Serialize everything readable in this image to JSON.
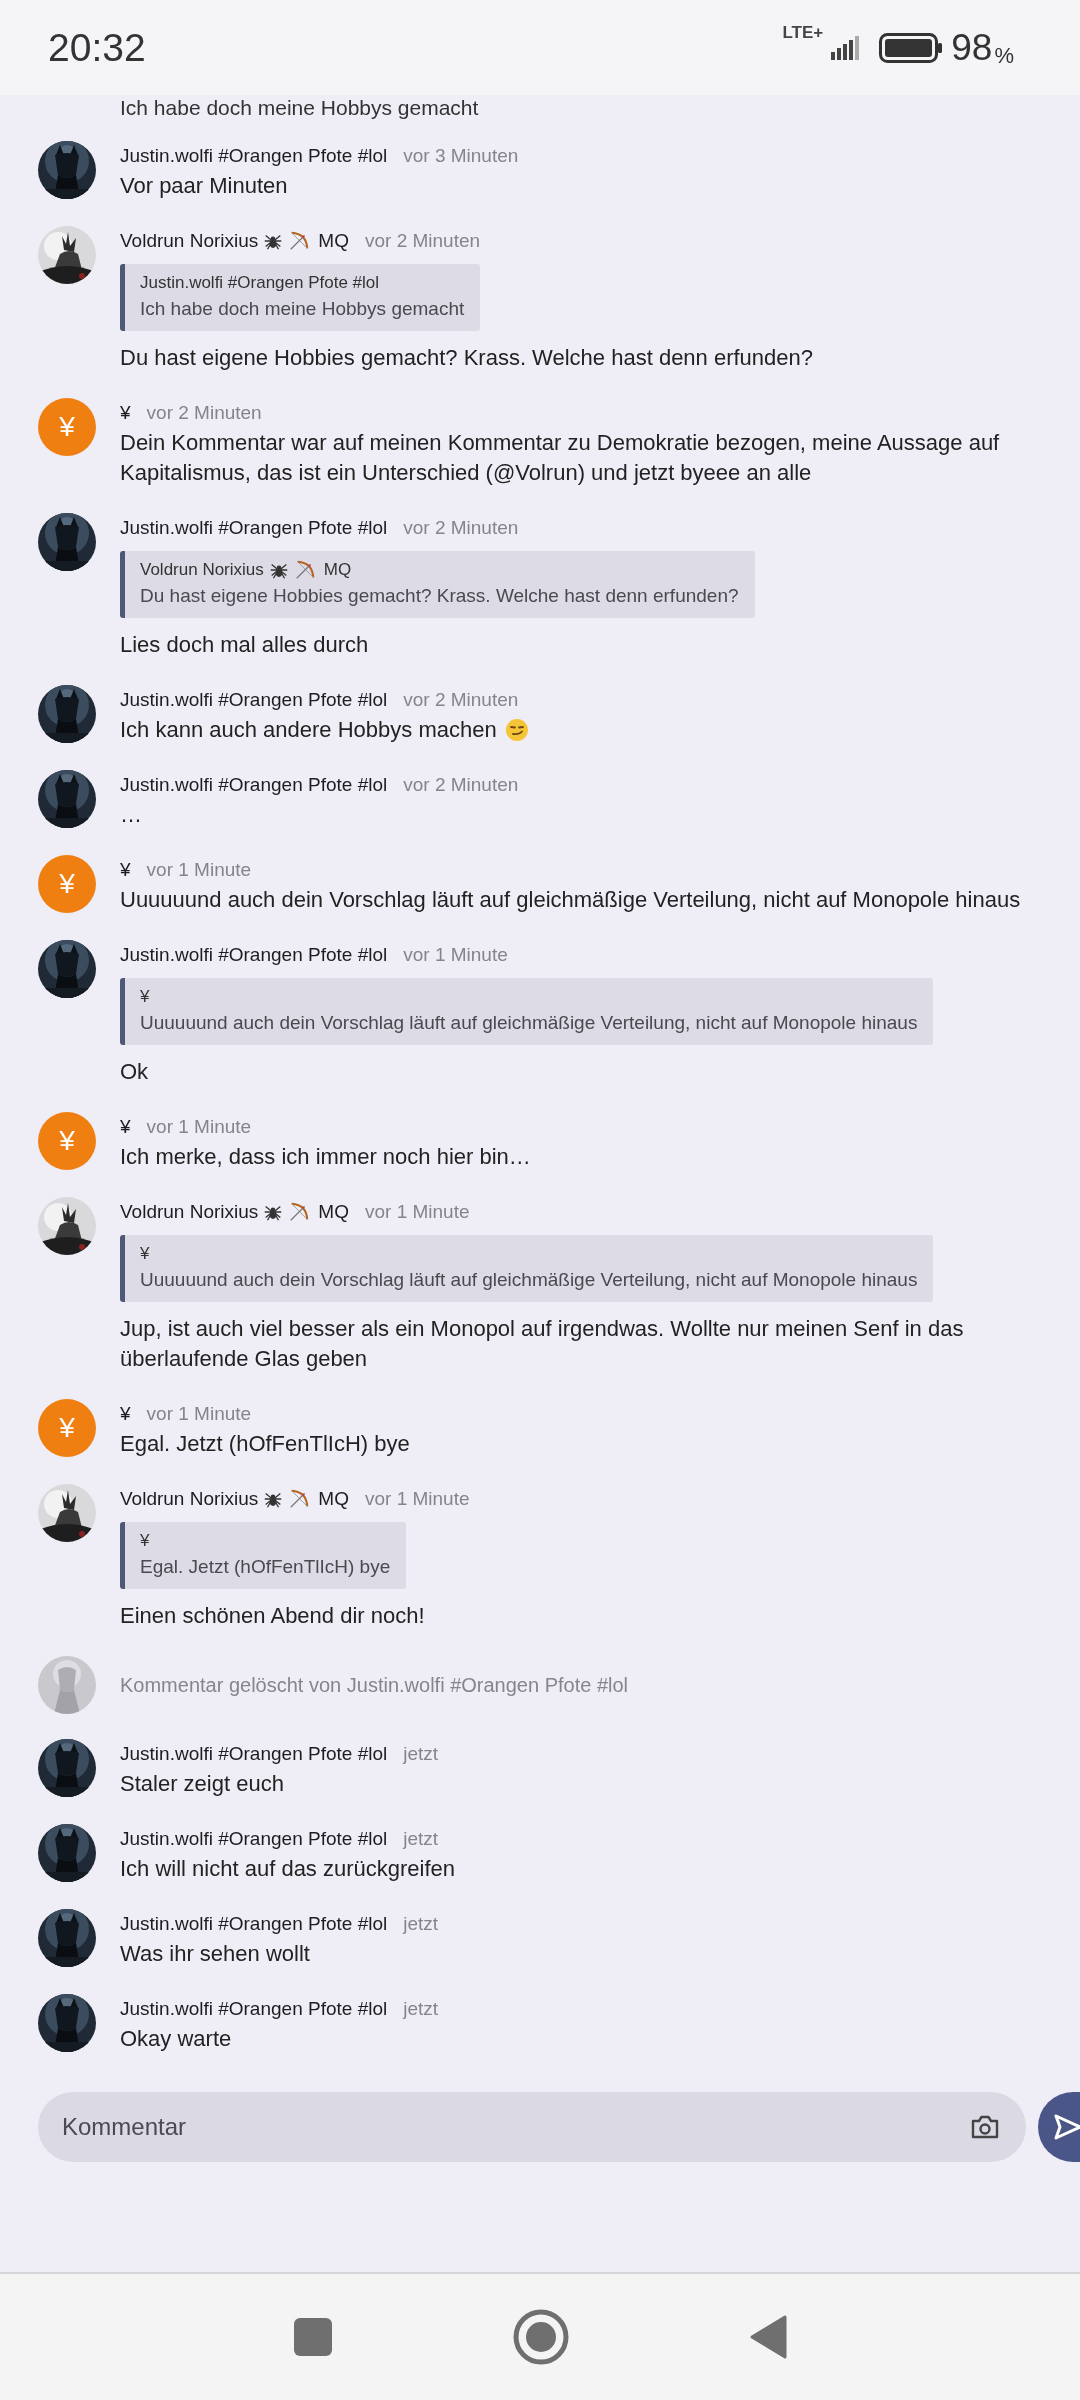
{
  "status_bar": {
    "time": "20:32",
    "network": "LTE+",
    "battery": "98",
    "battery_unit": "%"
  },
  "cut_text": "Ich habe doch meine Hobbys gemacht",
  "comments": [
    {
      "kind": "message",
      "avatar": {
        "kind": "picture_dark"
      },
      "author": "Justin.wolfi #Orangen Pfote #lol",
      "time": "vor 3 Minuten",
      "text": "Vor paar Minuten"
    },
    {
      "kind": "message",
      "avatar": {
        "kind": "picture_light"
      },
      "author": "Voldrun Norixius",
      "author_icons": [
        {
          "kind": "spider"
        },
        {
          "kind": "bow"
        }
      ],
      "tag": "MQ",
      "time": "vor 2 Minuten",
      "quote": {
        "author": "Justin.wolfi #Orangen Pfote #lol",
        "text": "Ich habe doch meine Hobbys gemacht"
      },
      "text": "Du hast eigene Hobbies gemacht? Krass. Welche hast denn erfunden?"
    },
    {
      "kind": "message",
      "avatar": {
        "kind": "letter",
        "text": "¥"
      },
      "author": "¥",
      "time": "vor 2 Minuten",
      "text": "Dein Kommentar war auf meinen Kommentar zu Demokratie bezogen, meine Aussage auf Kapitalismus, das ist ein Unterschied (@Volrun) und jetzt byeee an alle"
    },
    {
      "kind": "message",
      "avatar": {
        "kind": "picture_dark"
      },
      "author": "Justin.wolfi #Orangen Pfote #lol",
      "time": "vor 2 Minuten",
      "quote": {
        "author": "Voldrun Norixius",
        "author_icons": [
          {
            "kind": "spider"
          },
          {
            "kind": "bow"
          }
        ],
        "tag": "MQ",
        "text": "Du hast eigene Hobbies gemacht? Krass. Welche hast denn erfunden?"
      },
      "text": "Lies doch mal alles durch"
    },
    {
      "kind": "message",
      "avatar": {
        "kind": "picture_dark"
      },
      "author": "Justin.wolfi #Orangen Pfote #lol",
      "time": "vor 2 Minuten",
      "text": "Ich kann auch andere Hobbys machen",
      "text_icon": {
        "kind": "smirk"
      }
    },
    {
      "kind": "message",
      "avatar": {
        "kind": "picture_dark"
      },
      "author": "Justin.wolfi #Orangen Pfote #lol",
      "time": "vor 2 Minuten",
      "text": "…"
    },
    {
      "kind": "message",
      "avatar": {
        "kind": "letter",
        "text": "¥"
      },
      "author": "¥",
      "time": "vor 1 Minute",
      "text": "Uuuuuund auch dein Vorschlag läuft auf gleichmäßige Verteilung, nicht auf Monopole hinaus"
    },
    {
      "kind": "message",
      "avatar": {
        "kind": "picture_dark"
      },
      "author": "Justin.wolfi #Orangen Pfote #lol",
      "time": "vor 1 Minute",
      "quote": {
        "author": "¥",
        "text": "Uuuuuund auch dein Vorschlag läuft auf gleichmäßige Verteilung, nicht auf Monopole hinaus"
      },
      "text": "Ok"
    },
    {
      "kind": "message",
      "avatar": {
        "kind": "letter",
        "text": "¥"
      },
      "author": "¥",
      "time": "vor 1 Minute",
      "text": "Ich merke, dass ich immer noch hier bin…"
    },
    {
      "kind": "message",
      "avatar": {
        "kind": "picture_light"
      },
      "author": "Voldrun Norixius",
      "author_icons": [
        {
          "kind": "spider"
        },
        {
          "kind": "bow"
        }
      ],
      "tag": "MQ",
      "time": "vor 1 Minute",
      "quote": {
        "author": "¥",
        "text": "Uuuuuund auch dein Vorschlag läuft auf gleichmäßige Verteilung, nicht auf Monopole hinaus"
      },
      "text": "Jup, ist auch viel besser als ein Monopol auf irgendwas. Wollte nur meinen Senf in das überlaufende Glas geben"
    },
    {
      "kind": "message",
      "avatar": {
        "kind": "letter",
        "text": "¥"
      },
      "author": "¥",
      "time": "vor 1 Minute",
      "text": "Egal. Jetzt (hOfFenTlIcH) bye"
    },
    {
      "kind": "message",
      "avatar": {
        "kind": "picture_light"
      },
      "author": "Voldrun Norixius",
      "author_icons": [
        {
          "kind": "spider"
        },
        {
          "kind": "bow"
        }
      ],
      "tag": "MQ",
      "time": "vor 1 Minute",
      "quote": {
        "author": "¥",
        "text": "Egal. Jetzt (hOfFenTlIcH) bye"
      },
      "text": "Einen schönen Abend dir noch!"
    },
    {
      "kind": "deleted",
      "avatar": {
        "kind": "picture_faded"
      },
      "text": "Kommentar gelöscht von Justin.wolfi #Orangen Pfote #lol"
    },
    {
      "kind": "message",
      "avatar": {
        "kind": "picture_dark"
      },
      "author": "Justin.wolfi #Orangen Pfote #lol",
      "time": "jetzt",
      "text": "Staler zeigt euch"
    },
    {
      "kind": "message",
      "avatar": {
        "kind": "picture_dark"
      },
      "author": "Justin.wolfi #Orangen Pfote #lol",
      "time": "jetzt",
      "text": "Ich will nicht auf das zurückgreifen"
    },
    {
      "kind": "message",
      "avatar": {
        "kind": "picture_dark"
      },
      "author": "Justin.wolfi #Orangen Pfote #lol",
      "time": "jetzt",
      "text": "Was ihr sehen wollt"
    },
    {
      "kind": "message",
      "avatar": {
        "kind": "picture_dark"
      },
      "author": "Justin.wolfi #Orangen Pfote #lol",
      "time": "jetzt",
      "text": "Okay warte"
    }
  ],
  "composer": {
    "placeholder": "Kommentar"
  }
}
